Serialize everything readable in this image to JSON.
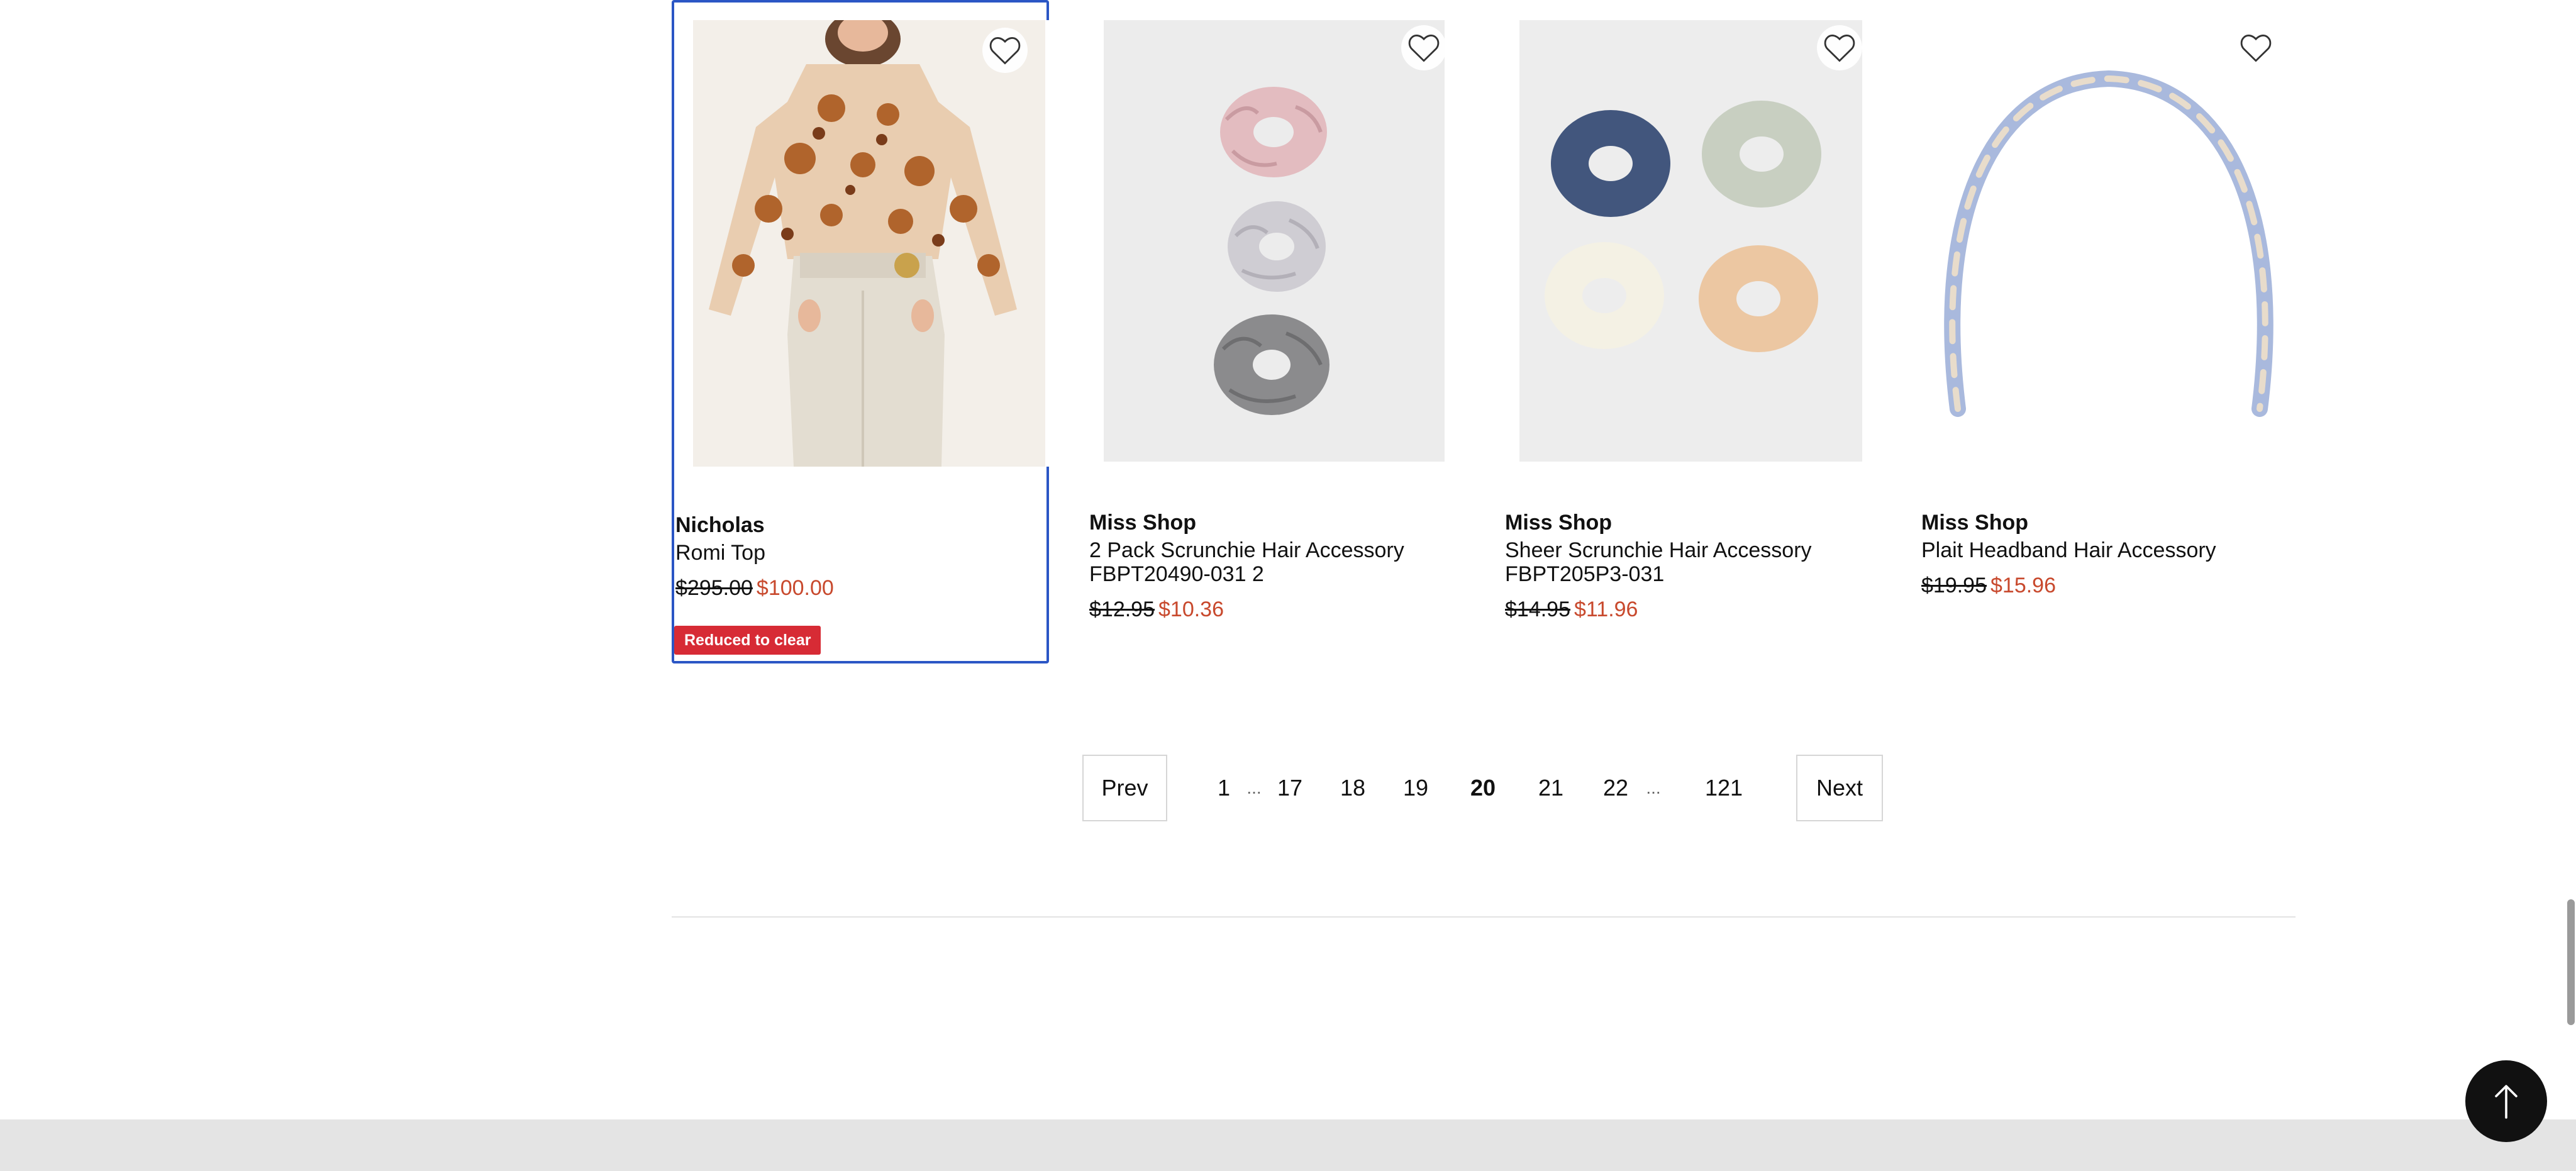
{
  "products": [
    {
      "brand": "Nicholas",
      "name": "Romi Top",
      "old_price": "$295.00",
      "new_price": "$100.00",
      "badge": "Reduced to clear",
      "image": "floral blouse with high-waisted trousers",
      "selected": true
    },
    {
      "brand": "Miss Shop",
      "name": "2 Pack Scrunchie Hair Accessory FBPT20490-031 2",
      "old_price": "$12.95",
      "new_price": "$10.36",
      "image": "three satin scrunchies"
    },
    {
      "brand": "Miss Shop",
      "name": "Sheer Scrunchie Hair Accessory FBPT205P3-031",
      "old_price": "$14.95",
      "new_price": "$11.96",
      "image": "four sheer scrunchies"
    },
    {
      "brand": "Miss Shop",
      "name": "Plait Headband Hair Accessory",
      "old_price": "$19.95",
      "new_price": "$15.96",
      "image": "plaited headband"
    }
  ],
  "icons": {
    "wishlist": "heart-outline-icon",
    "back_to_top": "arrow-up-icon"
  },
  "pagination": {
    "prev_label": "Prev",
    "next_label": "Next",
    "ellipsis": "...",
    "pages": [
      "1",
      "17",
      "18",
      "19",
      "20",
      "21",
      "22",
      "121"
    ],
    "current": "20"
  },
  "colors": {
    "sale_price": "#c8492d",
    "badge_bg": "#d72b35",
    "selected_border": "#2b56c5"
  }
}
